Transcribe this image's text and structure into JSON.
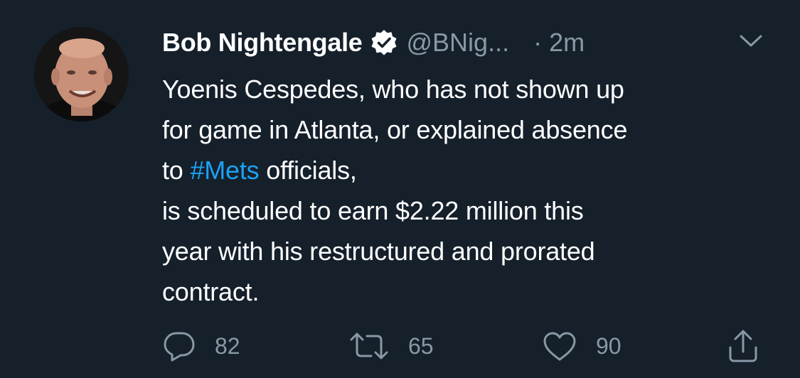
{
  "tweet": {
    "display_name": "Bob Nightengale",
    "handle": "@BNig...",
    "separator": "·",
    "time": "2m",
    "text_lines": {
      "l1": "Yoenis Cespedes, who has not shown up",
      "l2": "for game in Atlanta, or explained absence",
      "l3_pre": "to ",
      "l3_tag": "#Mets",
      "l3_post": " officials,",
      "l4": "is scheduled to earn $2.22 million this",
      "l5": "year with his restructured and prorated",
      "l6": "contract."
    },
    "counts": {
      "replies": "82",
      "retweets": "65",
      "likes": "90"
    }
  },
  "icons": {
    "verified": "verified-badge-icon",
    "caret": "chevron-down-icon",
    "reply": "reply-icon",
    "retweet": "retweet-icon",
    "like": "heart-icon",
    "share": "share-icon"
  },
  "colors": {
    "background": "#15202b",
    "text": "#ffffff",
    "secondary": "#8899a6",
    "accent": "#1da1f2"
  }
}
